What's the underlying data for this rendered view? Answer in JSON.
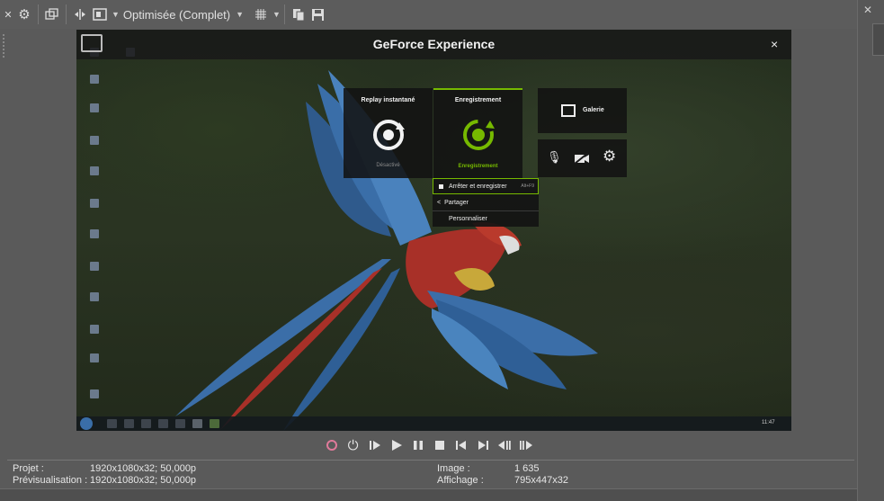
{
  "toolbar": {
    "quality_label": "Optimisée (Complet)"
  },
  "gfe": {
    "title": "GeForce Experience",
    "close_glyph": "×",
    "replay": {
      "title": "Replay instantané",
      "status": "Désactivé"
    },
    "record": {
      "title": "Enregistrement",
      "status": "Enregistrement"
    },
    "gallery": {
      "label": "Galerie"
    },
    "menu": {
      "items": [
        "Arrêter et enregistrer",
        "Partager",
        "Personnaliser"
      ],
      "shortcut": "Alt+F9"
    },
    "accent_color": "#76b900"
  },
  "taskbar": {
    "clock": "11:47"
  },
  "status": {
    "project_label": "Projet :",
    "project_value": "1920x1080x32; 50,000p",
    "preview_label": "Prévisualisation :",
    "preview_value": "1920x1080x32; 50,000p",
    "image_label": "Image :",
    "image_value": "1 635",
    "display_label": "Affichage :",
    "display_value": "795x447x32"
  },
  "icons": [
    "close-icon",
    "gear-icon",
    "preview-window-icon",
    "split-screen-icon",
    "overlay-icon",
    "grid-icon",
    "copy-icon",
    "save-icon",
    "record-icon",
    "loop-icon",
    "play-from-start-icon",
    "play-icon",
    "pause-icon",
    "stop-icon",
    "previous-frame-icon",
    "next-frame-icon",
    "previous-marker-icon",
    "next-marker-icon",
    "microphone-icon",
    "camera-off-icon",
    "settings-icon",
    "gallery-icon"
  ]
}
